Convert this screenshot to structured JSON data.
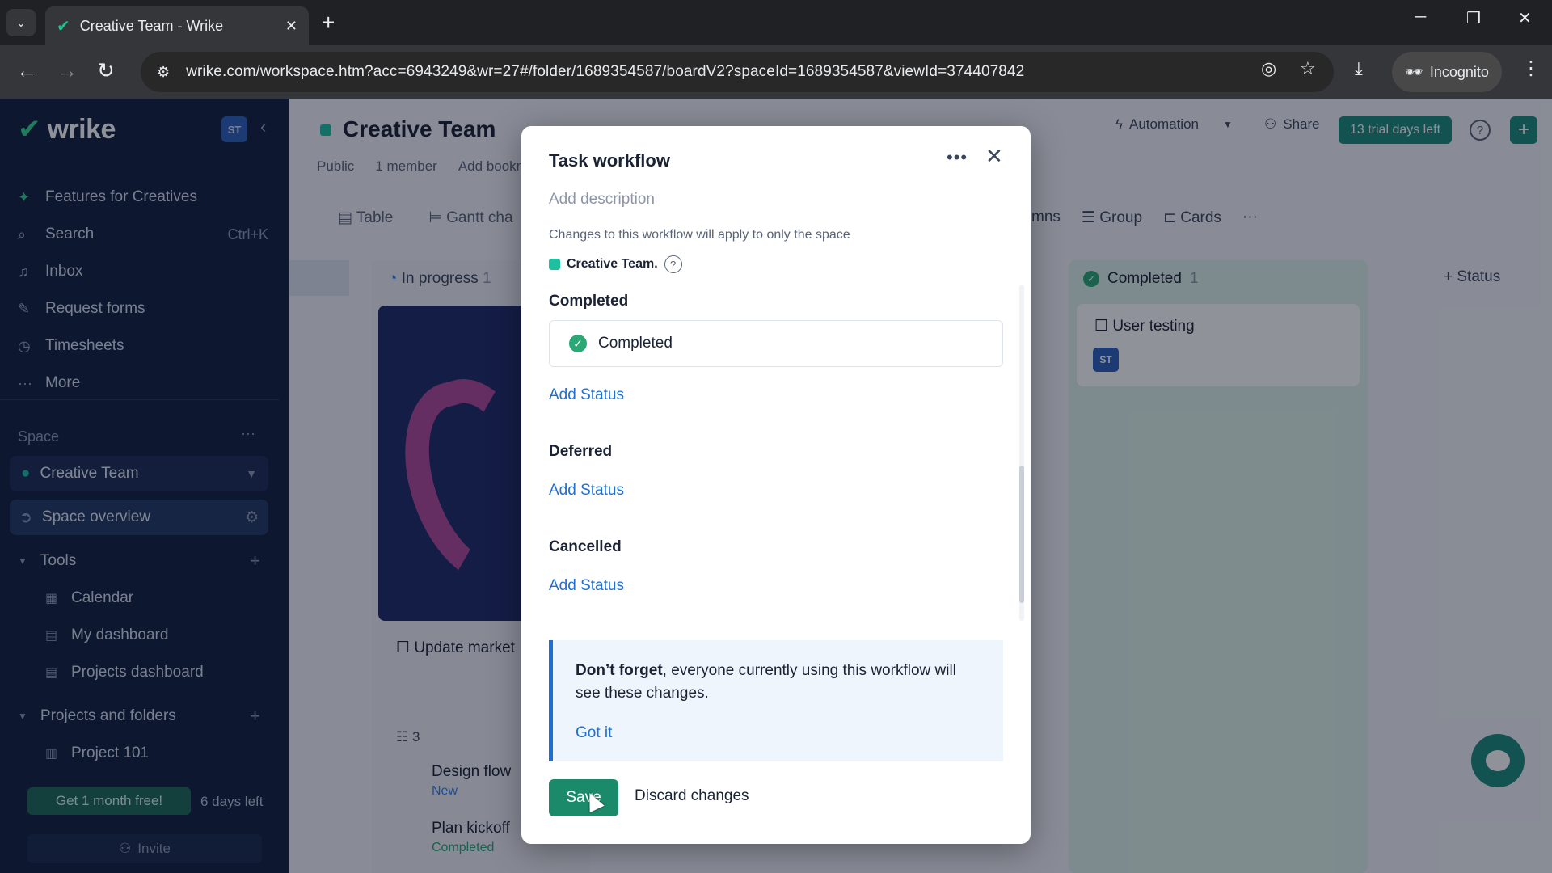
{
  "browser": {
    "tab_title": "Creative Team - Wrike",
    "url": "wrike.com/workspace.htm?acc=6943249&wr=27#/folder/1689354587/boardV2?spaceId=1689354587&viewId=374407842",
    "incognito_label": "Incognito"
  },
  "sidebar": {
    "logo_text": "wrike",
    "user_badge": "ST",
    "nav": [
      {
        "label": "Features for Creatives",
        "icon": "sparkle-icon"
      },
      {
        "label": "Search",
        "shortcut": "Ctrl+K",
        "icon": "search-icon"
      },
      {
        "label": "Inbox",
        "icon": "bell-icon"
      },
      {
        "label": "Request forms",
        "icon": "form-icon"
      },
      {
        "label": "Timesheets",
        "icon": "clock-icon"
      },
      {
        "label": "More",
        "icon": "more-icon"
      }
    ],
    "space_label": "Space",
    "space_name": "Creative Team",
    "space_overview": "Space overview",
    "tools_label": "Tools",
    "tools": [
      "Calendar",
      "My dashboard",
      "Projects dashboard"
    ],
    "projects_label": "Projects and folders",
    "projects": [
      "Project 101"
    ],
    "promo": "Get 1 month free!",
    "days_left": "6 days left",
    "invite": "Invite"
  },
  "main": {
    "title": "Creative Team",
    "meta": [
      "Public",
      "1 member",
      "Add bookm"
    ],
    "views": [
      "Table",
      "Gantt cha"
    ],
    "automation": "Automation",
    "share": "Share",
    "trial": "13 trial days left",
    "view_options": [
      "mns",
      "Group",
      "Cards"
    ],
    "col_in_progress": "In progress",
    "col_in_progress_count": "1",
    "col_completed": "Completed",
    "col_completed_count": "1",
    "add_status_col": "Status",
    "card_title": "Update market",
    "subtask_count": "3",
    "subtasks": [
      {
        "title": "Design flow",
        "status": "New"
      },
      {
        "title": "Plan kickoff",
        "status": "Completed"
      }
    ],
    "done_card_title": "User testing",
    "done_card_badge": "ST"
  },
  "modal": {
    "title": "Task workflow",
    "description_placeholder": "Add description",
    "note": "Changes to this workflow will apply to only the space",
    "space_name": "Creative Team.",
    "groups": [
      {
        "heading": "Completed",
        "statuses": [
          "Completed"
        ],
        "add_label": "Add Status"
      },
      {
        "heading": "Deferred",
        "statuses": [],
        "add_label": "Add Status"
      },
      {
        "heading": "Cancelled",
        "statuses": [],
        "add_label": "Add Status"
      }
    ],
    "callout_bold": "Don’t forget",
    "callout_text": ", everyone currently using this workflow will see these changes.",
    "callout_link": "Got it",
    "save": "Save",
    "discard": "Discard changes"
  },
  "colors": {
    "sidebar_bg": "#12213f",
    "accent_green": "#1b8a6b",
    "link_blue": "#1f6fd1",
    "completed_green": "#2aa876"
  }
}
